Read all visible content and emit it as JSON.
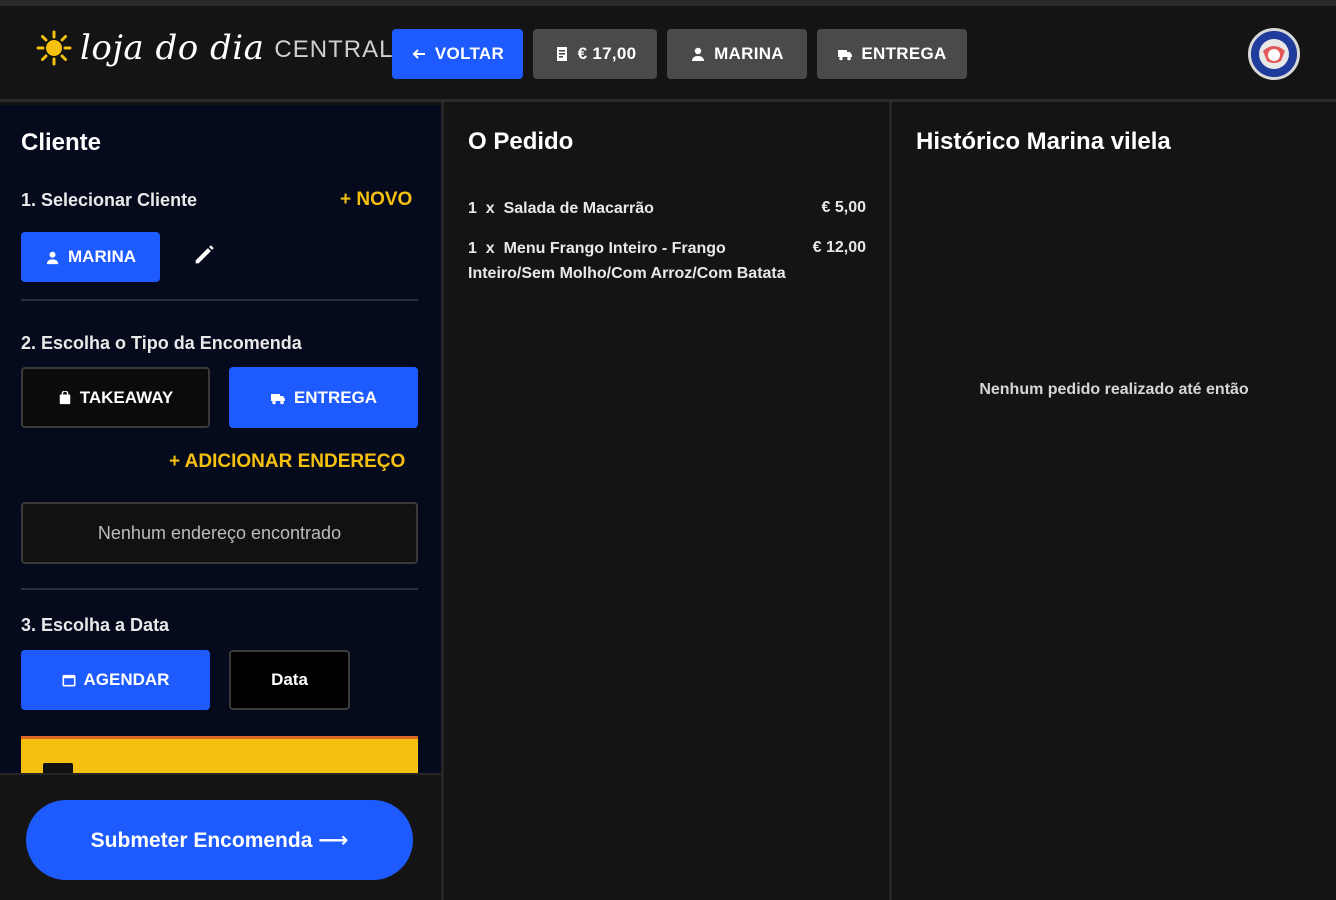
{
  "header": {
    "logo_script": "loja do dia",
    "logo_central": "CENTRAL",
    "back_label": "VOLTAR",
    "total_label": "€ 17,00",
    "customer_label": "MARINA",
    "delivery_label": "ENTREGA"
  },
  "cliente": {
    "title": "Cliente",
    "step1": "1. Selecionar Cliente",
    "new_label": "+ NOVO",
    "selected_customer": "MARINA",
    "step2": "2. Escolha o Tipo da Encomenda",
    "takeaway_label": "TAKEAWAY",
    "entrega_label": "ENTREGA",
    "add_address_label": "+ ADICIONAR  ENDEREÇO",
    "no_address": "Nenhum endereço encontrado",
    "step3": "3. Escolha a Data",
    "schedule_label": "AGENDAR",
    "date_label": "Data",
    "submit_label": "Submeter Encomenda ⟶"
  },
  "pedido": {
    "title": "O Pedido",
    "items": [
      {
        "qty": "1",
        "x": "x",
        "name": "Salada de Macarrão",
        "price": "€ 5,00"
      },
      {
        "qty": "1",
        "x": "x",
        "name": "Menu Frango Inteiro - Frango",
        "name2": "Inteiro/Sem Molho/Com Arroz/Com Batata",
        "price": "€ 12,00"
      }
    ]
  },
  "historico": {
    "title": "Histórico Marina vilela",
    "empty": "Nenhum pedido realizado até então"
  },
  "colors": {
    "accent": "#1e5bff",
    "highlight": "#f5c010",
    "panel": "#050a1c"
  }
}
